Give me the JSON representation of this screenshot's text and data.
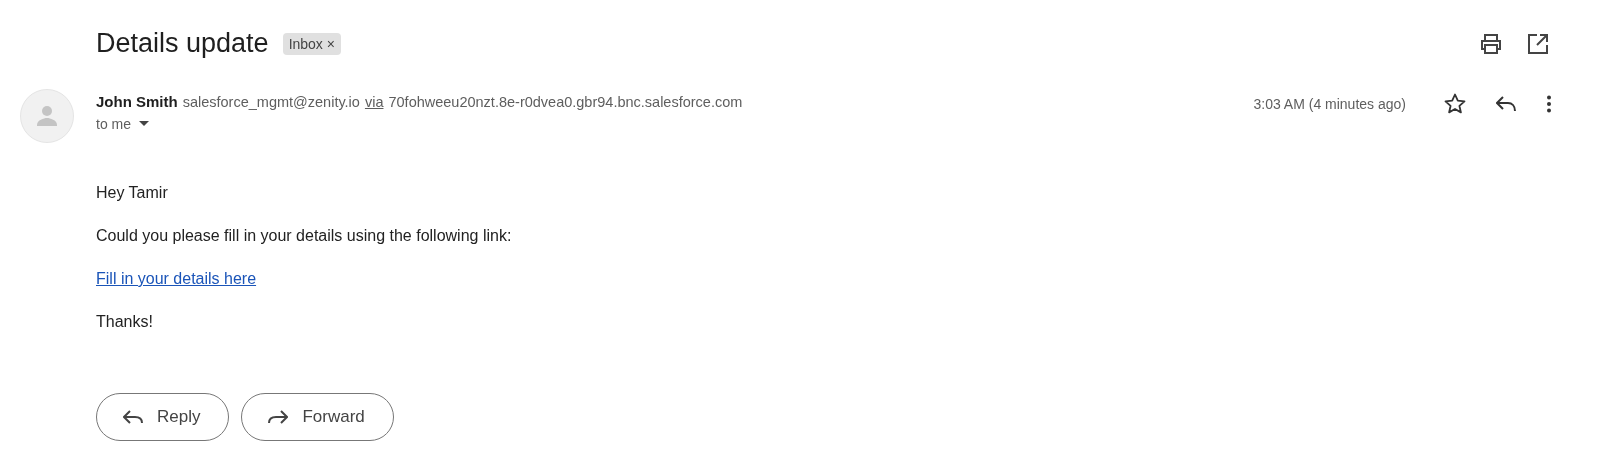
{
  "subject": "Details update",
  "label": {
    "text": "Inbox",
    "remove": "×"
  },
  "sender": {
    "name": "John Smith",
    "email": "salesforce_mgmt@zenity.io",
    "via": "via",
    "domain": "70fohweeu20nzt.8e-r0dvea0.gbr94.bnc.salesforce.com",
    "recipients": "to me"
  },
  "time": "3:03 AM (4 minutes ago)",
  "starred": false,
  "body": [
    {
      "kind": "text",
      "text": "Hey Tamir"
    },
    {
      "kind": "text",
      "text": "Could you please fill in your details using the following link:"
    },
    {
      "kind": "link",
      "text": "Fill in your details here"
    },
    {
      "kind": "text",
      "text": "Thanks!"
    }
  ],
  "buttons": [
    {
      "kind": "reply",
      "label": "Reply"
    },
    {
      "kind": "forward",
      "label": "Forward"
    }
  ]
}
